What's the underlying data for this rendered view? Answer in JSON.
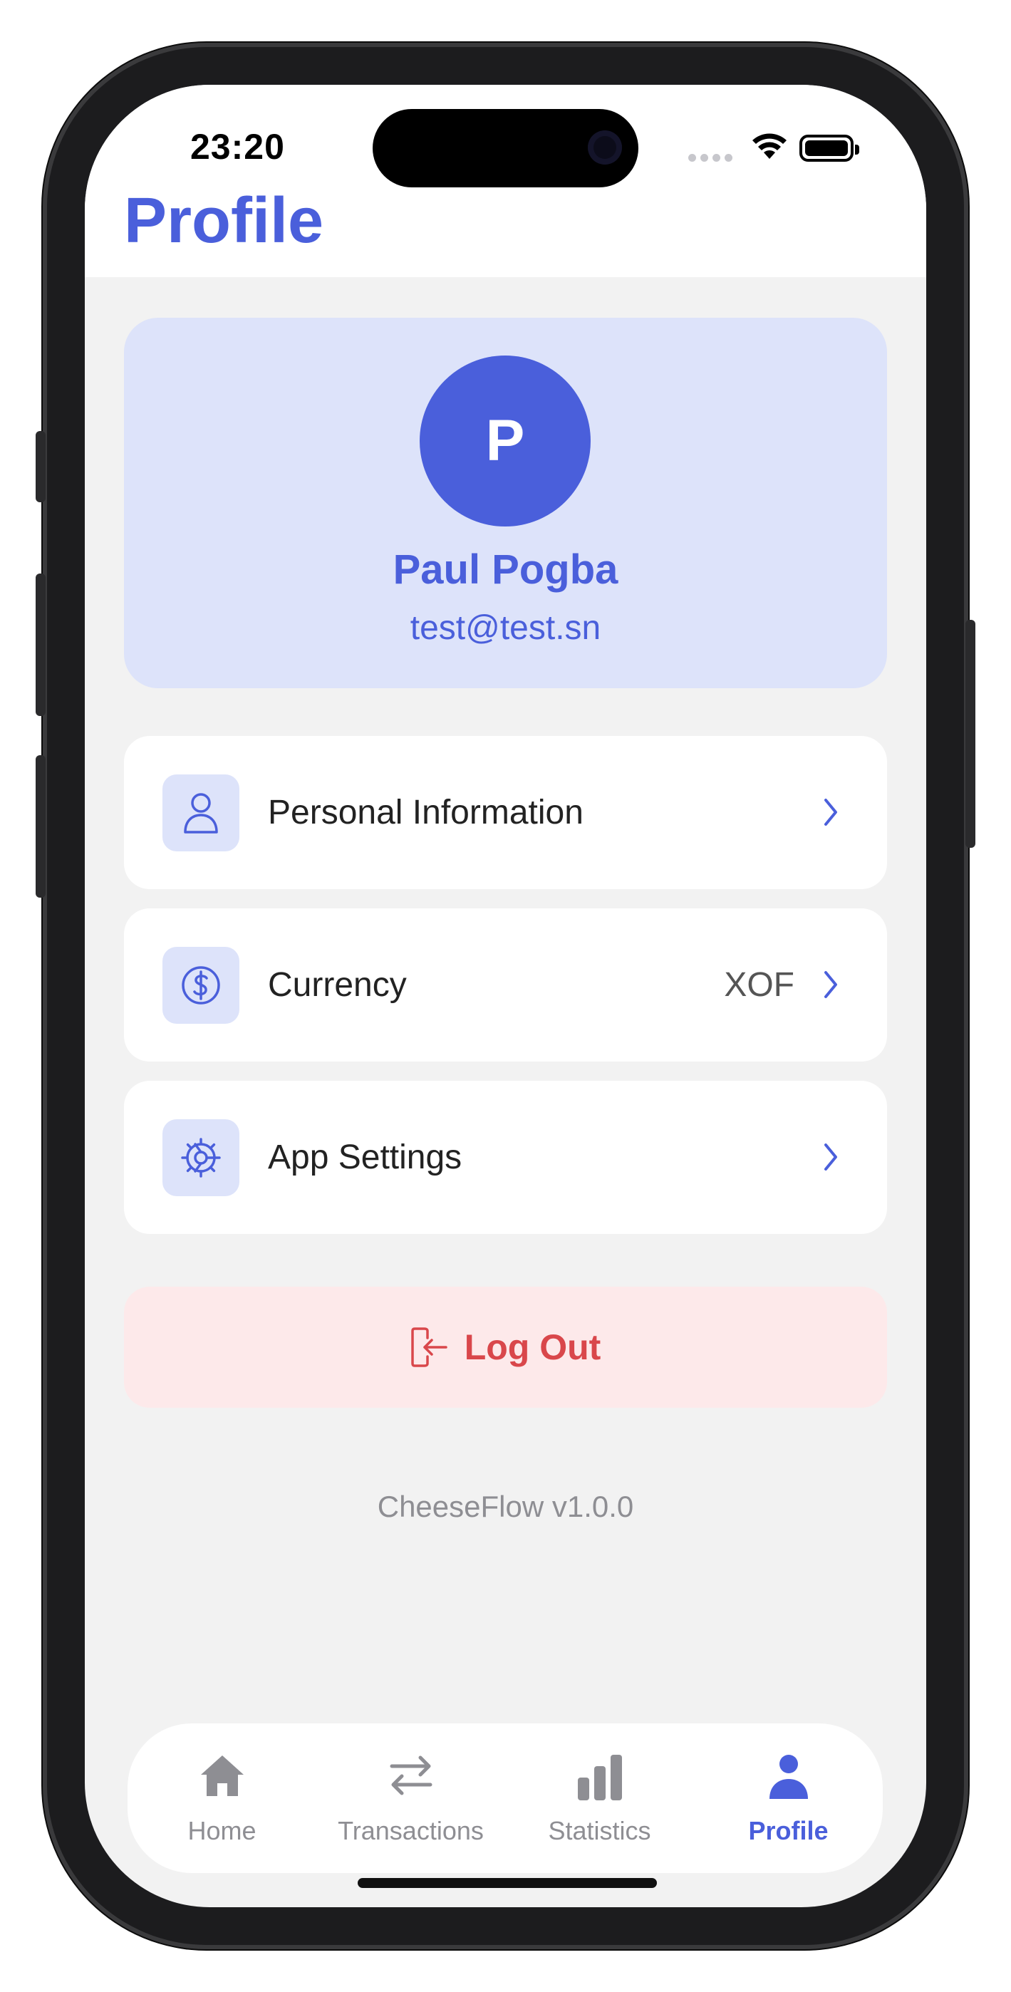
{
  "status_bar": {
    "time": "23:20"
  },
  "header": {
    "title": "Profile"
  },
  "profile": {
    "initial": "P",
    "name": "Paul Pogba",
    "email": "test@test.sn"
  },
  "menu": {
    "personal_info": {
      "label": "Personal Information",
      "icon": "user-icon"
    },
    "currency": {
      "label": "Currency",
      "value": "XOF",
      "icon": "dollar-circle-icon"
    },
    "app_settings": {
      "label": "App Settings",
      "icon": "gear-icon"
    }
  },
  "logout": {
    "label": "Log Out",
    "icon": "logout-icon"
  },
  "app_version": "CheeseFlow v1.0.0",
  "tabs": [
    {
      "label": "Home",
      "icon": "home-icon"
    },
    {
      "label": "Transactions",
      "icon": "transfer-arrows-icon"
    },
    {
      "label": "Statistics",
      "icon": "bar-chart-icon"
    },
    {
      "label": "Profile",
      "icon": "person-icon",
      "active": true
    }
  ],
  "colors": {
    "accent": "#4a5fdb",
    "accent_soft": "#dde3fa",
    "danger": "#d9474b",
    "danger_soft": "#fde9ea",
    "background": "#f2f2f2"
  }
}
